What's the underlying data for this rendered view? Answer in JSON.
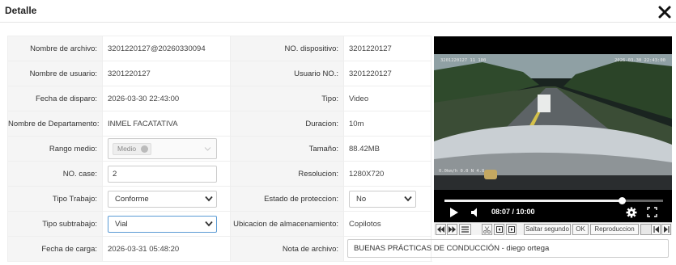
{
  "header": {
    "title": "Detalle"
  },
  "form": {
    "nombre_archivo": {
      "label": "Nombre de archivo:",
      "value": "3201220127@20260330094"
    },
    "dispositivo": {
      "label": "NO. dispositivo:",
      "value": "3201220127"
    },
    "nombre_usuario": {
      "label": "Nombre de usuario:",
      "value": "3201220127"
    },
    "usuario_no": {
      "label": "Usuario NO.:",
      "value": "3201220127"
    },
    "fecha_disparo": {
      "label": "Fecha de disparo:",
      "value": "2026-03-30 22:43:00"
    },
    "tipo": {
      "label": "Tipo:",
      "value": "Video"
    },
    "departamento": {
      "label": "Nombre de Departamento:",
      "value": "INMEL FACATATIVA"
    },
    "duracion": {
      "label": "Duracion:",
      "value": "10m"
    },
    "rango_medio": {
      "label": "Rango medio:",
      "tag": "Medio"
    },
    "tamano": {
      "label": "Tamaño:",
      "value": "88.42MB"
    },
    "no_case": {
      "label": "NO. case:",
      "value": "2"
    },
    "resolucion": {
      "label": "Resolucion:",
      "value": "1280X720"
    },
    "tipo_trabajo": {
      "label": "Tipo Trabajo:",
      "value": "Conforme"
    },
    "estado_proteccion": {
      "label": "Estado de proteccion:",
      "value": "No"
    },
    "tipo_subtrabajo": {
      "label": "Tipo subtrabajo:",
      "value": "Vial"
    },
    "ubicacion": {
      "label": "Ubicacion de almacenamiento:",
      "value": "Copilotos"
    },
    "fecha_carga": {
      "label": "Fecha de carga:",
      "value": "2026-03-31 05:48:20"
    },
    "nota_archivo": {
      "label": "Nota de archivo:",
      "value": "BUENAS PRÁCTICAS DE CONDUCCIÓN - diego ortega"
    }
  },
  "video": {
    "osd_left": "3201220127  11  100",
    "osd_right": "2026-03-30 22:43:00",
    "osd_speed": "0.0km/h  0.0  N 4.8",
    "time": "08:07 / 10:00",
    "progress": 0.81,
    "toolbar": {
      "skip_label": "Saltar segundo",
      "ok_label": "OK",
      "playback_label": "Reproduccion"
    }
  },
  "colors": {
    "video_bg": "#000000",
    "label_bg": "#f5f5f5",
    "focus_border": "#5b9bd5"
  }
}
